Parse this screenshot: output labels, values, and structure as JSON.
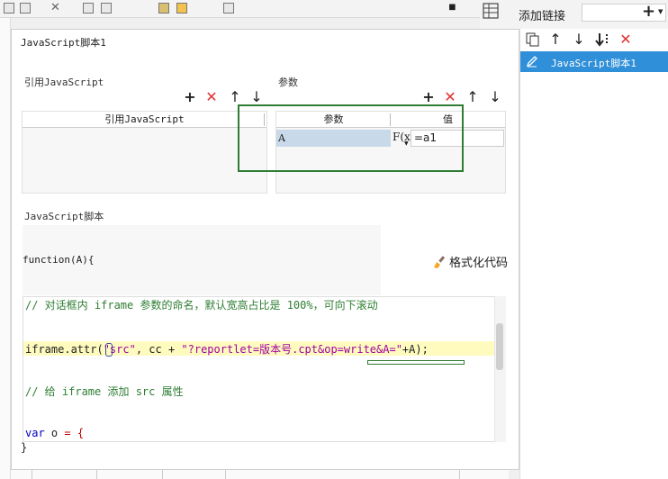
{
  "dialog": {
    "title": "JavaScript脚本1"
  },
  "ref_section": {
    "title": "引用JavaScript",
    "column_header": "引用JavaScript"
  },
  "param_section": {
    "title": "参数",
    "col_param": "参数",
    "col_value": "值",
    "rows": [
      {
        "name": "A",
        "value": "=a1"
      }
    ],
    "fx_label": "F(x)"
  },
  "script_section": {
    "title": "JavaScript脚本",
    "fn_signature": "function(A){",
    "format_button": "格式化代码",
    "closing_brace": "}"
  },
  "editor": {
    "lines": {
      "comment1": "// 对话框内 iframe 参数的命名，默认宽高占比是 100%，可向下滚动",
      "code1_a": "iframe.attr(",
      "code1_str1": "\"src\"",
      "code1_b": ", cc + ",
      "code1_str2": "\"?reportlet=版本号.cpt&op=write&A=\"",
      "code1_c": "+A);",
      "comment2": "// 给 iframe 添加 src 属性",
      "code2_kw": "var",
      "code2_a": " o ",
      "code2_op": "= {"
    }
  },
  "side_panel": {
    "add_link_label": "添加链接",
    "items": [
      {
        "label": "JavaScript脚本1"
      }
    ]
  },
  "icons": {
    "plus": "+",
    "delete": "✕",
    "up": "↑",
    "down": "↓"
  },
  "colors": {
    "accent": "#2f8fd8",
    "highlight_green": "#2e7d32",
    "delete_red": "#e53030",
    "selected_cell": "#c8daea"
  }
}
